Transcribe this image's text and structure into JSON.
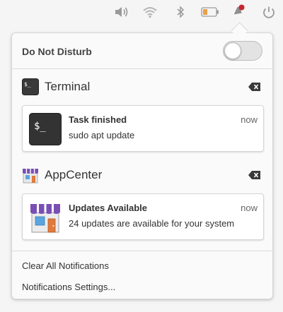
{
  "topbar": {
    "icons": [
      "volume-icon",
      "wifi-icon",
      "bluetooth-icon",
      "battery-icon",
      "notifications-icon",
      "power-icon"
    ],
    "notification_dot_color": "#c6262e"
  },
  "dnd": {
    "label": "Do Not Disturb",
    "enabled": false
  },
  "groups": [
    {
      "app_name": "Terminal",
      "icon": "terminal-icon",
      "notification": {
        "title": "Task finished",
        "body": "sudo apt update",
        "time": "now"
      }
    },
    {
      "app_name": "AppCenter",
      "icon": "appcenter-icon",
      "notification": {
        "title": "Updates Available",
        "body": "24 updates are available for your system",
        "time": "now"
      }
    }
  ],
  "footer": {
    "clear_all": "Clear All Notifications",
    "settings": "Notifications Settings..."
  }
}
